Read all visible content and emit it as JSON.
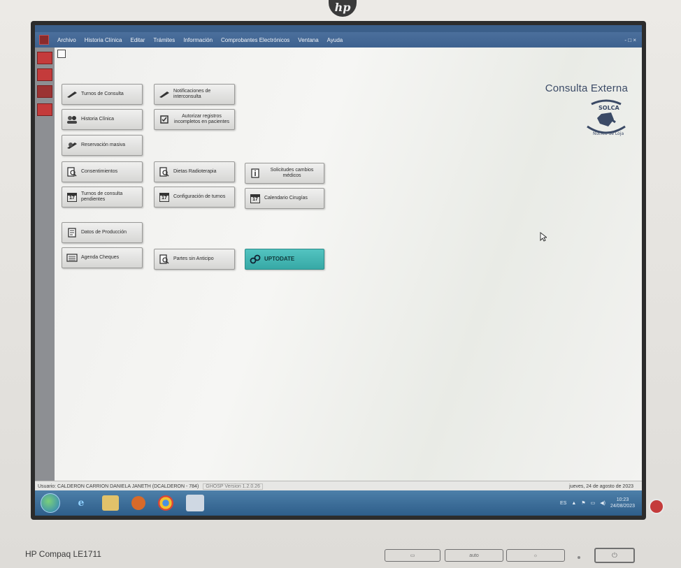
{
  "monitor": {
    "brand_logo": "hp",
    "model": "HP Compaq LE1711",
    "button_labels": [
      "auto"
    ]
  },
  "menubar": {
    "items": [
      "Archivo",
      "Historia Clínica",
      "Editar",
      "Trámites",
      "Información",
      "Comprobantes Electrónicos",
      "Ventana",
      "Ayuda"
    ],
    "window_controls": "- □ ×"
  },
  "buttons": {
    "turnos_consulta": "Turnos de Consulta",
    "notificaciones": "Notificaciones de interconsulta",
    "historia_clinica": "Historia Clínica",
    "autorizar_registros": "Autorizar registros incompletos en pacientes",
    "reservacion_masiva": "Reservación masiva",
    "consentimientos": "Consentimientos",
    "dietas_radioterapia": "Dietas Radioterapia",
    "solicitudes_cambios": "Solicitudes cambios médicos",
    "turnos_pendientes": "Turnos de consulta pendientes",
    "configuracion_turnos": "Configuración de turnos",
    "calendario_cirugias": "Calendario Cirugías",
    "datos_produccion": "Datos de Producción",
    "agenda_cheques": "Agenda Cheques",
    "partes_anticipo": "Partes sin Anticipo",
    "uptodate": "UPTODATE"
  },
  "brand": {
    "title": "Consulta Externa",
    "logo_text": "SOLCA Núcleo de Loja"
  },
  "status": {
    "user": "Usuario: CALDERON CARRION DANIELA JANETH (DCALDERON - 784)",
    "version": "GHOSP Version 1.2.0.26",
    "date": "jueves, 24 de agosto de 2023"
  },
  "tray": {
    "lang": "ES",
    "time": "10:23",
    "date": "24/08/2023"
  },
  "colors": {
    "menubar": "#3e628f",
    "teal_button": "#3fb3b0",
    "brand_text": "#3b4a66",
    "taskbar": "#2e5e8a"
  }
}
